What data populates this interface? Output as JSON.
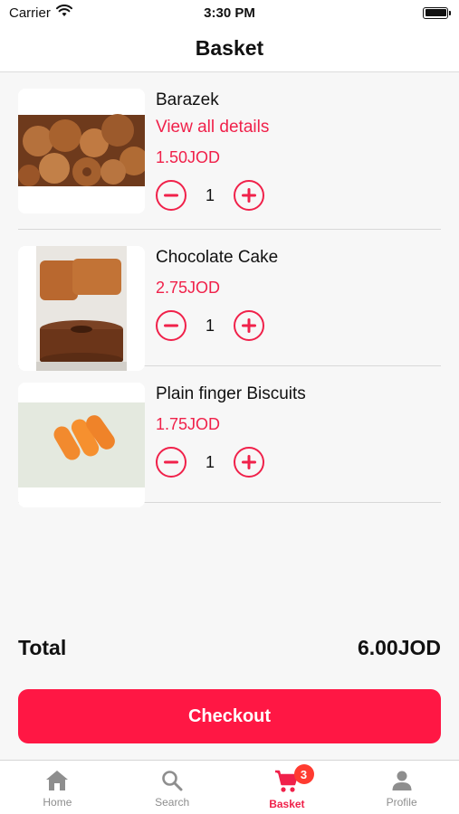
{
  "status_bar": {
    "carrier": "Carrier",
    "time": "3:30 PM"
  },
  "header": {
    "title": "Basket"
  },
  "items": [
    {
      "name": "Barazek",
      "link": "View all details",
      "price": "1.50JOD",
      "quantity": "1",
      "image_icon": "barazek-cookies-photo"
    },
    {
      "name": "Chocolate Cake",
      "price": "2.75JOD",
      "quantity": "1",
      "image_icon": "chocolate-cake-photo"
    },
    {
      "name": "Plain finger Biscuits",
      "price": "1.75JOD",
      "quantity": "1",
      "image_icon": "finger-biscuits-photo"
    }
  ],
  "summary": {
    "total_label": "Total",
    "total_value": "6.00JOD"
  },
  "checkout": {
    "label": "Checkout"
  },
  "tabs": [
    {
      "label": "Home",
      "icon": "home-icon"
    },
    {
      "label": "Search",
      "icon": "search-icon"
    },
    {
      "label": "Basket",
      "icon": "cart-icon",
      "badge": "3",
      "active": true
    },
    {
      "label": "Profile",
      "icon": "profile-icon"
    }
  ],
  "colors": {
    "accent": "#f0214a",
    "checkout": "#ff1744",
    "badge": "#ff3b30",
    "background": "#f7f7f7",
    "inactive_tab": "#8e8e8e"
  }
}
